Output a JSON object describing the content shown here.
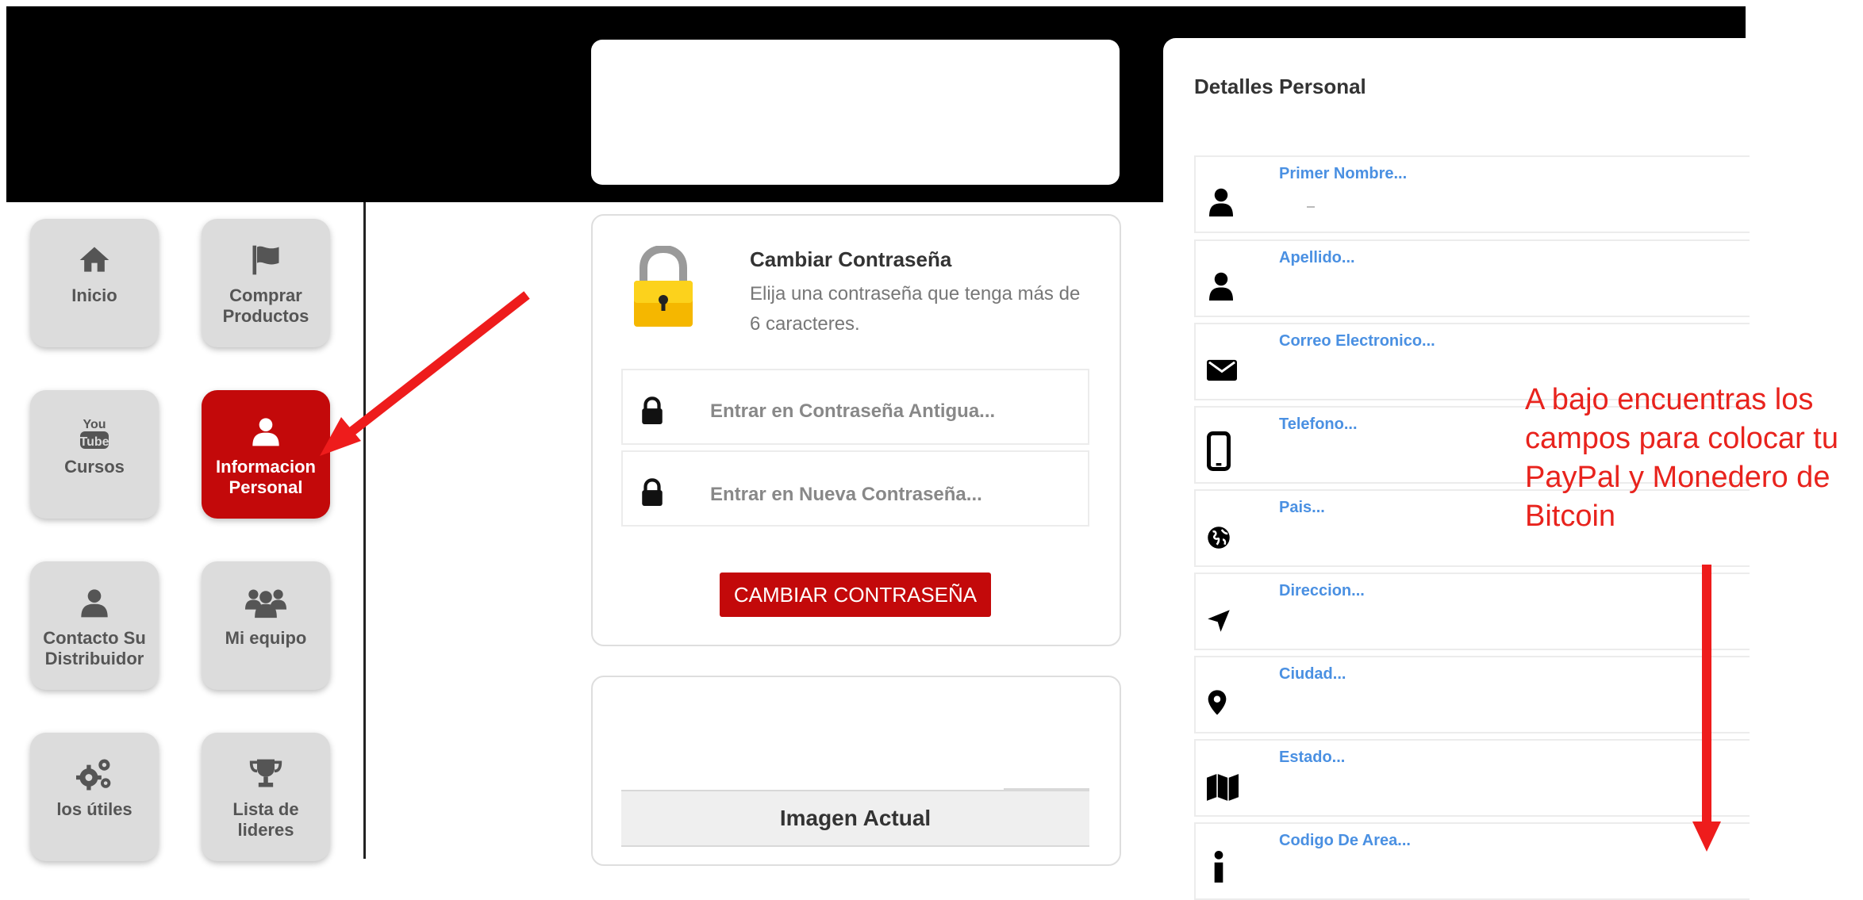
{
  "sidebar": {
    "items": [
      {
        "label": "Inicio",
        "icon": "home-icon"
      },
      {
        "label": "Comprar Productos",
        "icon": "flag-icon"
      },
      {
        "label": "Cursos",
        "icon": "youtube-icon"
      },
      {
        "label": "Informacion Personal",
        "icon": "user-icon"
      },
      {
        "label": "Contacto Su Distribuidor",
        "icon": "user-icon"
      },
      {
        "label": "Mi equipo",
        "icon": "users-icon"
      },
      {
        "label": "los útiles",
        "icon": "cogs-icon"
      },
      {
        "label": "Lista de lideres",
        "icon": "trophy-icon"
      }
    ],
    "active": "Informacion Personal",
    "active_color": "#c3090a"
  },
  "password": {
    "title": "Cambiar Contraseña",
    "description": "Elija una contraseña que tenga más de 6 caracteres.",
    "old_placeholder": "Entrar en Contraseña Antigua...",
    "new_placeholder": "Entrar en Nueva Contraseña...",
    "button_label": "CAMBIAR CONTRASEÑA"
  },
  "image": {
    "header": "Imagen Actual"
  },
  "details": {
    "title": "Detalles Personal",
    "fields": [
      {
        "label": "Primer Nombre...",
        "icon": "user-icon"
      },
      {
        "label": "Apellido...",
        "icon": "user-icon"
      },
      {
        "label": "Correo Electronico...",
        "icon": "envelope-icon"
      },
      {
        "label": "Telefono...",
        "icon": "mobile-phone-icon"
      },
      {
        "label": "Pais...",
        "icon": "globe-icon"
      },
      {
        "label": "Direccion...",
        "icon": "location-arrow-icon"
      },
      {
        "label": "Ciudad...",
        "icon": "map-marker-icon"
      },
      {
        "label": "Estado...",
        "icon": "map-icon"
      },
      {
        "label": "Codigo De Area...",
        "icon": "info-icon"
      }
    ]
  },
  "annotation": {
    "text": "A bajo encuentras los campos para colocar tu PayPal y Monedero de Bitcoin",
    "color": "#e8231d"
  }
}
